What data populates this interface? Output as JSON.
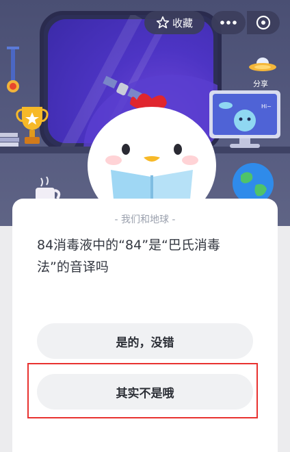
{
  "header": {
    "favorite_label": "收藏",
    "share_label": "分享",
    "monitor_bubble": "Hi~"
  },
  "quiz": {
    "category": "- 我们和地球 -",
    "question": "84消毒液中的“84”是“巴氏消毒法”的音译吗",
    "options": [
      {
        "label": "是的，没错"
      },
      {
        "label": "其实不是哦"
      }
    ]
  },
  "colors": {
    "highlight": "#e8312f",
    "hero_bg": "#4f5478",
    "option_bg": "#f0f1f3"
  },
  "icons": [
    "star-icon",
    "more-icon",
    "close-target-icon",
    "share-ufo-icon"
  ]
}
